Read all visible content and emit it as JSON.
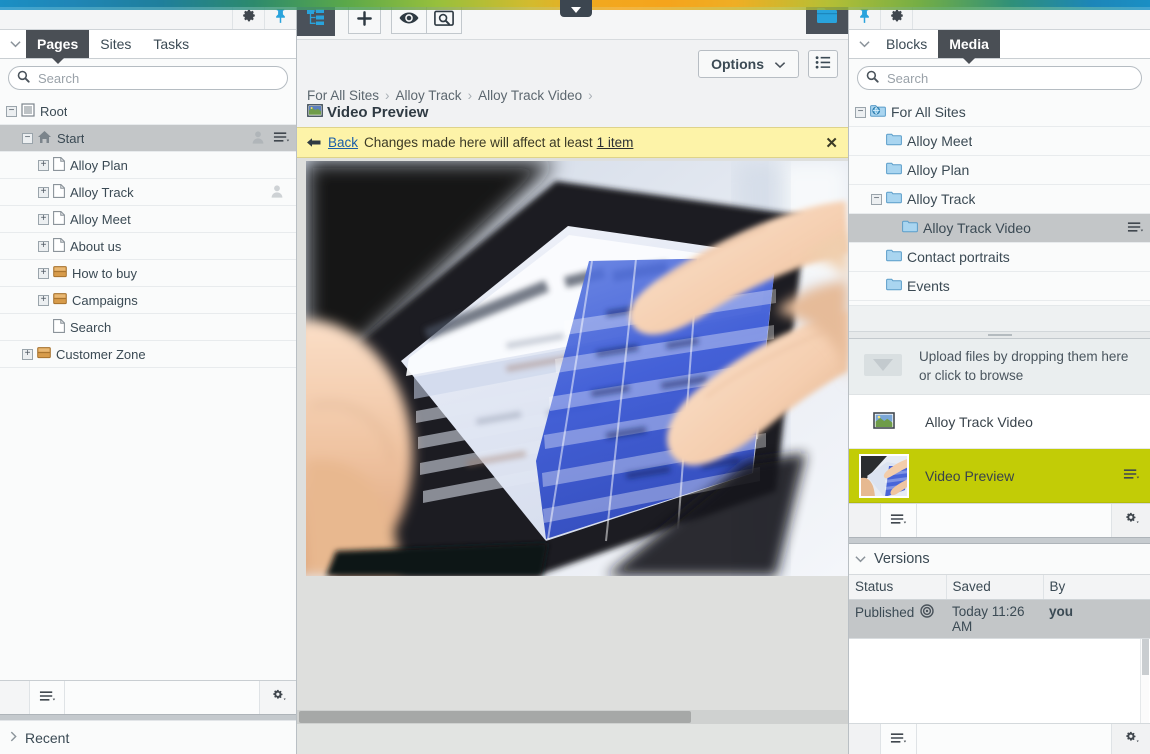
{
  "window": {
    "title": "Episerver CMS Edit Mode",
    "accent_hex": "#c2cc06",
    "notice_bg_hex": "#fdf3a8",
    "selection_hex": "#c3c6c8"
  },
  "top_bar": {
    "pull_tab_icon": "chevron-down-icon",
    "gradient_colors": [
      "#1a8fc4",
      "#2c8a6d",
      "#97c03c",
      "#f2a81e",
      "#b5bf35",
      "#1c86b9"
    ]
  },
  "left_panel": {
    "toolbar": {
      "gear_icon": "gear-icon",
      "pin_icon": "pin-icon"
    },
    "collapse_icon": "chevron-down-icon",
    "tabs": [
      {
        "label": "Pages",
        "active": true
      },
      {
        "label": "Sites",
        "active": false
      },
      {
        "label": "Tasks",
        "active": false
      }
    ],
    "search": {
      "placeholder": "Search",
      "value": "",
      "icon": "search-icon"
    },
    "tree": [
      {
        "label": "Root",
        "icon": "root-icon",
        "expander": "minus",
        "indent": 0,
        "selected": false,
        "has_user": false,
        "has_menu": false
      },
      {
        "label": "Start",
        "icon": "home-icon",
        "expander": "minus",
        "indent": 1,
        "selected": true,
        "has_user": true,
        "has_menu": true
      },
      {
        "label": "Alloy Plan",
        "icon": "page-icon",
        "expander": "plus",
        "indent": 2,
        "selected": false,
        "has_user": false,
        "has_menu": false
      },
      {
        "label": "Alloy Track",
        "icon": "page-icon",
        "expander": "plus",
        "indent": 2,
        "selected": false,
        "has_user": true,
        "has_menu": false
      },
      {
        "label": "Alloy Meet",
        "icon": "page-icon",
        "expander": "plus",
        "indent": 2,
        "selected": false,
        "has_user": false,
        "has_menu": false
      },
      {
        "label": "About us",
        "icon": "page-icon",
        "expander": "plus",
        "indent": 2,
        "selected": false,
        "has_user": false,
        "has_menu": false
      },
      {
        "label": "How to buy",
        "icon": "container-icon",
        "expander": "plus",
        "indent": 2,
        "selected": false,
        "has_user": false,
        "has_menu": false
      },
      {
        "label": "Campaigns",
        "icon": "container-icon",
        "expander": "plus",
        "indent": 2,
        "selected": false,
        "has_user": false,
        "has_menu": false
      },
      {
        "label": "Search",
        "icon": "page-icon",
        "expander": "none",
        "indent": 2,
        "selected": false,
        "has_user": false,
        "has_menu": false
      },
      {
        "label": "Customer Zone",
        "icon": "container-icon",
        "expander": "plus",
        "indent": 1,
        "selected": false,
        "has_user": false,
        "has_menu": false
      }
    ],
    "footer": {
      "menu_icon": "hamburger-menu-icon",
      "gear_icon": "gear-icon"
    },
    "recent": {
      "label": "Recent",
      "icon": "chevron-right-icon"
    }
  },
  "center": {
    "toolbar": {
      "navigation_icon": "sitemap-icon",
      "add_icon": "plus-icon",
      "view_icon": "eye-icon",
      "preview_icon": "preview-icon",
      "assets_icon": "folder-icon"
    },
    "options_button": {
      "label": "Options",
      "caret_icon": "chevron-down-icon"
    },
    "list_button": {
      "icon": "list-icon"
    },
    "breadcrumbs": [
      "For All Sites",
      "Alloy Track",
      "Alloy Track Video"
    ],
    "page_title": {
      "label": "Video Preview",
      "icon": "image-icon"
    },
    "notice": {
      "back_label": "Back",
      "back_arrow_icon": "arrow-left-icon",
      "message": "Changes made here will affect at least",
      "item_link": "1 item",
      "close_icon": "close-icon"
    },
    "preview": {
      "alt": "Hands using a tablet showing a spreadsheet budget document",
      "scrollbar": "horizontal-scrollbar"
    }
  },
  "right_panel": {
    "toolbar": {
      "pin_icon": "pin-icon",
      "gear_icon": "gear-icon"
    },
    "collapse_icon": "chevron-down-icon",
    "tabs": [
      {
        "label": "Blocks",
        "active": false
      },
      {
        "label": "Media",
        "active": true
      }
    ],
    "search": {
      "placeholder": "Search",
      "value": "",
      "icon": "search-icon"
    },
    "tree": [
      {
        "label": "For All Sites",
        "icon": "globe-folder-icon",
        "expander": "minus",
        "indent": 0,
        "selected": false,
        "has_menu": false
      },
      {
        "label": "Alloy Meet",
        "icon": "folder-icon",
        "expander": "none",
        "indent": 1,
        "selected": false,
        "has_menu": false
      },
      {
        "label": "Alloy Plan",
        "icon": "folder-icon",
        "expander": "none",
        "indent": 1,
        "selected": false,
        "has_menu": false
      },
      {
        "label": "Alloy Track",
        "icon": "folder-icon",
        "expander": "minus",
        "indent": 1,
        "selected": false,
        "has_menu": false
      },
      {
        "label": "Alloy Track Video",
        "icon": "folder-icon",
        "expander": "none",
        "indent": 2,
        "selected": true,
        "has_menu": true
      },
      {
        "label": "Contact portraits",
        "icon": "folder-icon",
        "expander": "none",
        "indent": 1,
        "selected": false,
        "has_menu": false
      },
      {
        "label": "Events",
        "icon": "folder-icon",
        "expander": "none",
        "indent": 1,
        "selected": false,
        "has_menu": false
      }
    ],
    "upload": {
      "icon": "upload-arrow-icon",
      "line1": "Upload files by dropping them here",
      "line2": "or click to browse"
    },
    "media_items": [
      {
        "name": "Alloy Track Video",
        "icon": "image-icon",
        "selected": false,
        "has_menu": false,
        "thumb": "none"
      },
      {
        "name": "Video Preview",
        "icon": "image-thumb",
        "selected": true,
        "has_menu": true,
        "thumb": "tablet-photo"
      }
    ],
    "media_footer": {
      "menu_icon": "hamburger-menu-icon",
      "gear_icon": "gear-icon"
    },
    "versions": {
      "title": "Versions",
      "collapse_icon": "chevron-down-icon",
      "columns": [
        "Status",
        "Saved",
        "By"
      ],
      "rows": [
        {
          "status": "Published",
          "status_icon": "published-icon",
          "saved": "Today 11:26 AM",
          "by": "you",
          "selected": true
        }
      ],
      "footer": {
        "menu_icon": "hamburger-menu-icon",
        "gear_icon": "gear-icon"
      }
    }
  }
}
